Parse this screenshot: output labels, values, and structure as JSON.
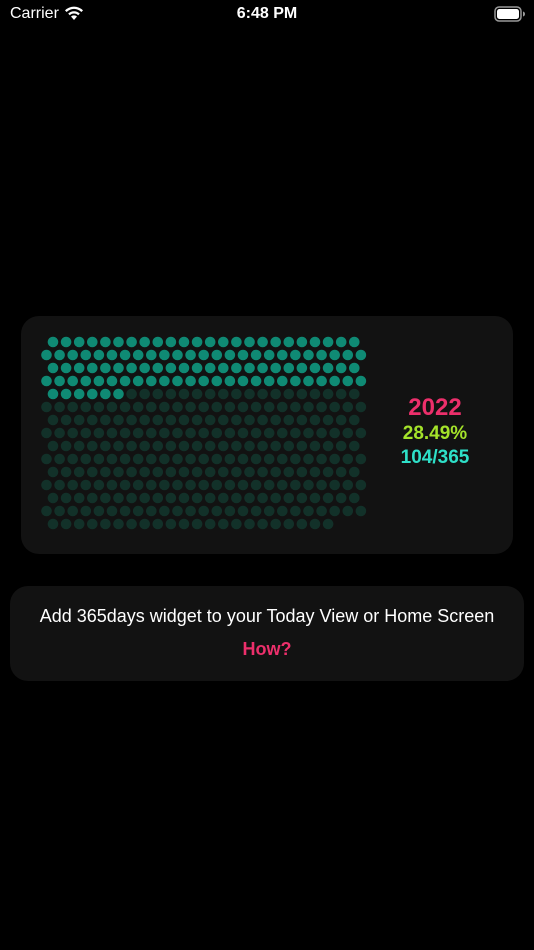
{
  "status_bar": {
    "carrier": "Carrier",
    "time": "6:48 PM",
    "wifi_icon": "wifi-icon",
    "battery_icon": "battery-icon"
  },
  "widget": {
    "year": "2022",
    "percent": "28.49%",
    "days": "104/365",
    "days_elapsed": 104,
    "days_total": 365,
    "colors": {
      "elapsed_dot": "#0f8a74",
      "remaining_dot": "#123129",
      "year_text": "#ec2f6b",
      "percent_text": "#a4e32a",
      "count_text": "#2ee0c8"
    }
  },
  "info": {
    "text": "Add 365days widget to your Today View or Home Screen",
    "link": "How?"
  }
}
